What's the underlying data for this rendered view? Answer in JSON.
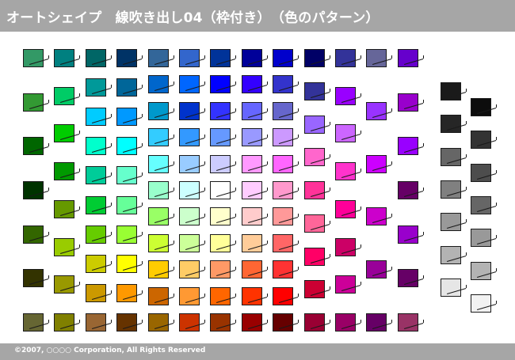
{
  "header": {
    "title": "オートシェイプ　線吹き出し04（枠付き）　（色のパターン）"
  },
  "footer": {
    "copyright": "©2007, ○○○○ Corporation, All Rights Reserved"
  },
  "palette": {
    "color_columns": [
      [
        "#339966",
        "#339933",
        "#006600",
        "#003300",
        "#336600",
        "#333300",
        "#666633"
      ],
      [
        "#008080",
        "#00CC66",
        "#00CC00",
        "#009900",
        "#669900",
        "#99CC00",
        "#999900",
        "#808000"
      ],
      [
        "#006666",
        "#009999",
        "#00CCFF",
        "#00FFCC",
        "#00CC99",
        "#00CC33",
        "#66CC00",
        "#CCCC00",
        "#CC9900",
        "#996633"
      ],
      [
        "#003366",
        "#006699",
        "#0099FF",
        "#00FFFF",
        "#66FFCC",
        "#66FF99",
        "#99FF33",
        "#FFFF00",
        "#FF9900",
        "#663300"
      ],
      [
        "#336699",
        "#0066CC",
        "#0099CC",
        "#33CCFF",
        "#66FFFF",
        "#99FFCC",
        "#99FF66",
        "#CCFF33",
        "#FFCC00",
        "#CC6600",
        "#996600"
      ],
      [
        "#3366CC",
        "#0066FF",
        "#0033CC",
        "#3399FF",
        "#99CCFF",
        "#CCFFFF",
        "#CCFFCC",
        "#CCFF99",
        "#FFCC66",
        "#FF9933",
        "#CC3300"
      ],
      [
        "#003399",
        "#0000FF",
        "#3333FF",
        "#6699FF",
        "#CCCCFF",
        "#FFFFFF",
        "#FFFFCC",
        "#FFFF99",
        "#FF9966",
        "#FF6600",
        "#993300"
      ],
      [
        "#000099",
        "#3300FF",
        "#6666FF",
        "#9999FF",
        "#FF99FF",
        "#FFCCFF",
        "#FFCCCC",
        "#FFCC99",
        "#FF6633",
        "#FF3300",
        "#990000"
      ],
      [
        "#0000CC",
        "#3333CC",
        "#6666CC",
        "#CC99FF",
        "#FF66FF",
        "#FF99CC",
        "#FF9999",
        "#FF6666",
        "#FF3333",
        "#FF0000",
        "#660000"
      ],
      [
        "#000066",
        "#333399",
        "#9966FF",
        "#FF66CC",
        "#FF3399",
        "#FF6699",
        "#FF0066",
        "#CC0033",
        "#990033"
      ],
      [
        "#333399",
        "#9900FF",
        "#CC66FF",
        "#FF33CC",
        "#FF0099",
        "#CC0066",
        "#CC0099",
        "#990066"
      ],
      [
        "#666699",
        "#9933FF",
        "#CC00FF",
        "#CC00CC",
        "#990099",
        "#660066"
      ],
      [
        "#6600CC",
        "#9900CC",
        "#9900FF",
        "#660066",
        "#9900CC",
        "#660066",
        "#993366"
      ]
    ],
    "gray_columns": [
      [
        "#1A1A1A",
        "#262626",
        "#666666",
        "#808080",
        "#999999",
        "#B3B3B3",
        "#E6E6E6"
      ],
      [
        "#0D0D0D",
        "#333333",
        "#4D4D4D",
        "#666666",
        "#999999",
        "#B3B3B3",
        "#F2F2F2"
      ]
    ]
  }
}
